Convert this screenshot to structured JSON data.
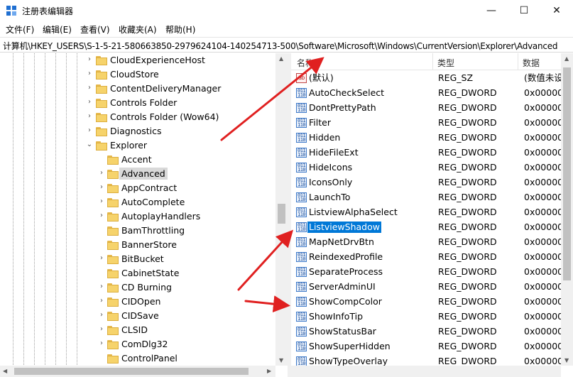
{
  "window": {
    "title": "注册表编辑器",
    "controls": {
      "minimize": "—",
      "maximize": "☐",
      "close": "✕"
    }
  },
  "menu": [
    "文件(F)",
    "编辑(E)",
    "查看(V)",
    "收藏夹(A)",
    "帮助(H)"
  ],
  "address": "计算机\\HKEY_USERS\\S-1-5-21-580663850-2979624104-140254713-500\\Software\\Microsoft\\Windows\\CurrentVersion\\Explorer\\Advanced",
  "tree": {
    "items": [
      {
        "label": "CloudExperienceHost",
        "expander": "›",
        "selected": false
      },
      {
        "label": "CloudStore",
        "expander": "›",
        "selected": false
      },
      {
        "label": "ContentDeliveryManager",
        "expander": "›",
        "selected": false
      },
      {
        "label": "Controls Folder",
        "expander": "›",
        "selected": false
      },
      {
        "label": "Controls Folder (Wow64)",
        "expander": "›",
        "selected": false
      },
      {
        "label": "Diagnostics",
        "expander": "›",
        "selected": false
      },
      {
        "label": "Explorer",
        "expander": "⌄",
        "selected": false
      },
      {
        "label": "Accent",
        "expander": "",
        "selected": false
      },
      {
        "label": "Advanced",
        "expander": "›",
        "selected": true
      },
      {
        "label": "AppContract",
        "expander": "›",
        "selected": false
      },
      {
        "label": "AutoComplete",
        "expander": "›",
        "selected": false
      },
      {
        "label": "AutoplayHandlers",
        "expander": "›",
        "selected": false
      },
      {
        "label": "BamThrottling",
        "expander": "",
        "selected": false
      },
      {
        "label": "BannerStore",
        "expander": "",
        "selected": false
      },
      {
        "label": "BitBucket",
        "expander": "›",
        "selected": false
      },
      {
        "label": "CabinetState",
        "expander": "",
        "selected": false
      },
      {
        "label": "CD Burning",
        "expander": "›",
        "selected": false
      },
      {
        "label": "CIDOpen",
        "expander": "›",
        "selected": false
      },
      {
        "label": "CIDSave",
        "expander": "›",
        "selected": false
      },
      {
        "label": "CLSID",
        "expander": "›",
        "selected": false
      },
      {
        "label": "ComDlg32",
        "expander": "›",
        "selected": false
      },
      {
        "label": "ControlPanel",
        "expander": "",
        "selected": false
      }
    ]
  },
  "list": {
    "columns": [
      "名称",
      "类型",
      "数据"
    ],
    "rows": [
      {
        "name": "(默认)",
        "type": "REG_SZ",
        "data": "(数值未设",
        "kind": "sz",
        "selected": false
      },
      {
        "name": "AutoCheckSelect",
        "type": "REG_DWORD",
        "data": "0x000000",
        "kind": "dword",
        "selected": false
      },
      {
        "name": "DontPrettyPath",
        "type": "REG_DWORD",
        "data": "0x000000",
        "kind": "dword",
        "selected": false
      },
      {
        "name": "Filter",
        "type": "REG_DWORD",
        "data": "0x000000",
        "kind": "dword",
        "selected": false
      },
      {
        "name": "Hidden",
        "type": "REG_DWORD",
        "data": "0x000000",
        "kind": "dword",
        "selected": false
      },
      {
        "name": "HideFileExt",
        "type": "REG_DWORD",
        "data": "0x000000",
        "kind": "dword",
        "selected": false
      },
      {
        "name": "HideIcons",
        "type": "REG_DWORD",
        "data": "0x000000",
        "kind": "dword",
        "selected": false
      },
      {
        "name": "IconsOnly",
        "type": "REG_DWORD",
        "data": "0x000000",
        "kind": "dword",
        "selected": false
      },
      {
        "name": "LaunchTo",
        "type": "REG_DWORD",
        "data": "0x000000",
        "kind": "dword",
        "selected": false
      },
      {
        "name": "ListviewAlphaSelect",
        "type": "REG_DWORD",
        "data": "0x000000",
        "kind": "dword",
        "selected": false
      },
      {
        "name": "ListviewShadow",
        "type": "REG_DWORD",
        "data": "0x000000",
        "kind": "dword",
        "selected": true
      },
      {
        "name": "MapNetDrvBtn",
        "type": "REG_DWORD",
        "data": "0x000000",
        "kind": "dword",
        "selected": false
      },
      {
        "name": "ReindexedProfile",
        "type": "REG_DWORD",
        "data": "0x000000",
        "kind": "dword",
        "selected": false
      },
      {
        "name": "SeparateProcess",
        "type": "REG_DWORD",
        "data": "0x000000",
        "kind": "dword",
        "selected": false
      },
      {
        "name": "ServerAdminUI",
        "type": "REG_DWORD",
        "data": "0x000000",
        "kind": "dword",
        "selected": false
      },
      {
        "name": "ShowCompColor",
        "type": "REG_DWORD",
        "data": "0x000000",
        "kind": "dword",
        "selected": false
      },
      {
        "name": "ShowInfoTip",
        "type": "REG_DWORD",
        "data": "0x000000",
        "kind": "dword",
        "selected": false
      },
      {
        "name": "ShowStatusBar",
        "type": "REG_DWORD",
        "data": "0x000000",
        "kind": "dword",
        "selected": false
      },
      {
        "name": "ShowSuperHidden",
        "type": "REG_DWORD",
        "data": "0x000000",
        "kind": "dword",
        "selected": false
      },
      {
        "name": "ShowTypeOverlay",
        "type": "REG_DWORD",
        "data": "0x000000",
        "kind": "dword",
        "selected": false
      }
    ]
  },
  "colors": {
    "selection": "#0078d7",
    "annotation_arrow": "#e02020"
  }
}
